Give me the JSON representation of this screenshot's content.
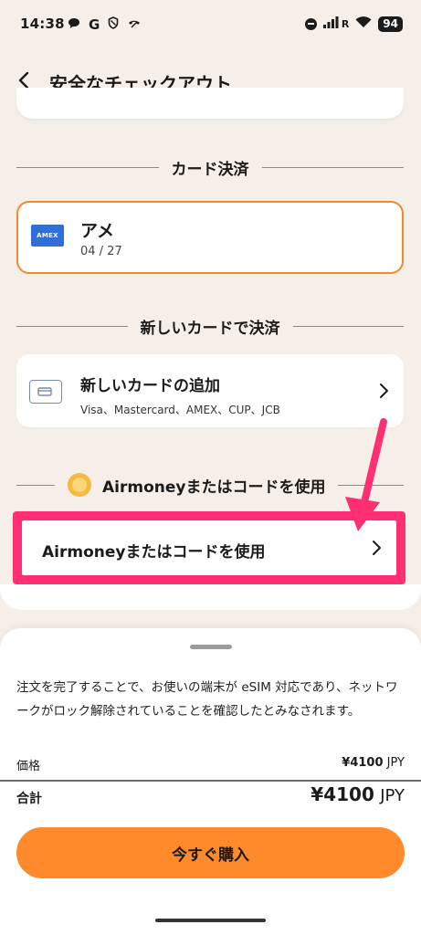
{
  "status_bar": {
    "time": "14:38",
    "left_icons": [
      "chat-icon",
      "google-icon",
      "shield-icon",
      "call-icon"
    ],
    "carrier_mark": "R",
    "battery": "94"
  },
  "header": {
    "title": "安全なチェックアウト"
  },
  "card_payment": {
    "section_label": "カード決済",
    "saved_card": {
      "brand_badge": "AMEX",
      "name": "アメ",
      "expiry": "04 / 27"
    }
  },
  "new_card_payment": {
    "section_label": "新しいカードで決済",
    "add_card": {
      "title": "新しいカードの追加",
      "networks": "Visa、Mastercard、AMEX、CUP、JCB"
    }
  },
  "airmoney": {
    "section_label": "Airmoneyまたはコードを使用",
    "button_label": "Airmoneyまたはコードを使用",
    "highlight_color": "#ff2f74"
  },
  "summary": {
    "notice": "注文を完了することで、お使いの端末が eSIM 対応であり、ネットワークがロック解除されていることを確認したとみなされます。",
    "price_label": "価格",
    "price_amount": "¥4100",
    "price_currency": "JPY",
    "total_label": "合計",
    "total_amount": "¥4100",
    "total_currency": "JPY",
    "buy_label": "今すぐ購入"
  },
  "colors": {
    "accent": "#ff8a2b",
    "selected_border": "#f08a2a",
    "background": "#f6efe9"
  }
}
